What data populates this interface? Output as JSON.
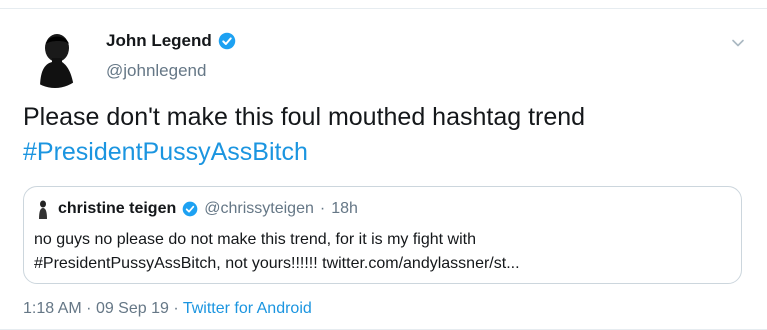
{
  "author": {
    "name": "John Legend",
    "handle": "@johnlegend",
    "verified": true
  },
  "tweet": {
    "text": "Please don't make this foul mouthed hashtag trend",
    "hashtag": "#PresidentPussyAssBitch"
  },
  "quoted": {
    "name": "christine teigen",
    "handle": "@chrissyteigen",
    "separator": "·",
    "time": "18h",
    "line1": "no guys no please do not make this trend, for it is my fight with",
    "line2": "#PresidentPussyAssBitch, not yours!!!!!! twitter.com/andylassner/st..."
  },
  "meta": {
    "time": "1:18 AM",
    "sep1": "·",
    "date": "09 Sep 19",
    "sep2": "·",
    "source": "Twitter for Android"
  },
  "colors": {
    "accent": "#1b95e0",
    "verified": "#1da1f2",
    "secondary_text": "#657786"
  },
  "icons": {
    "verified": "verified-badge-icon",
    "menu": "chevron-down-icon"
  }
}
